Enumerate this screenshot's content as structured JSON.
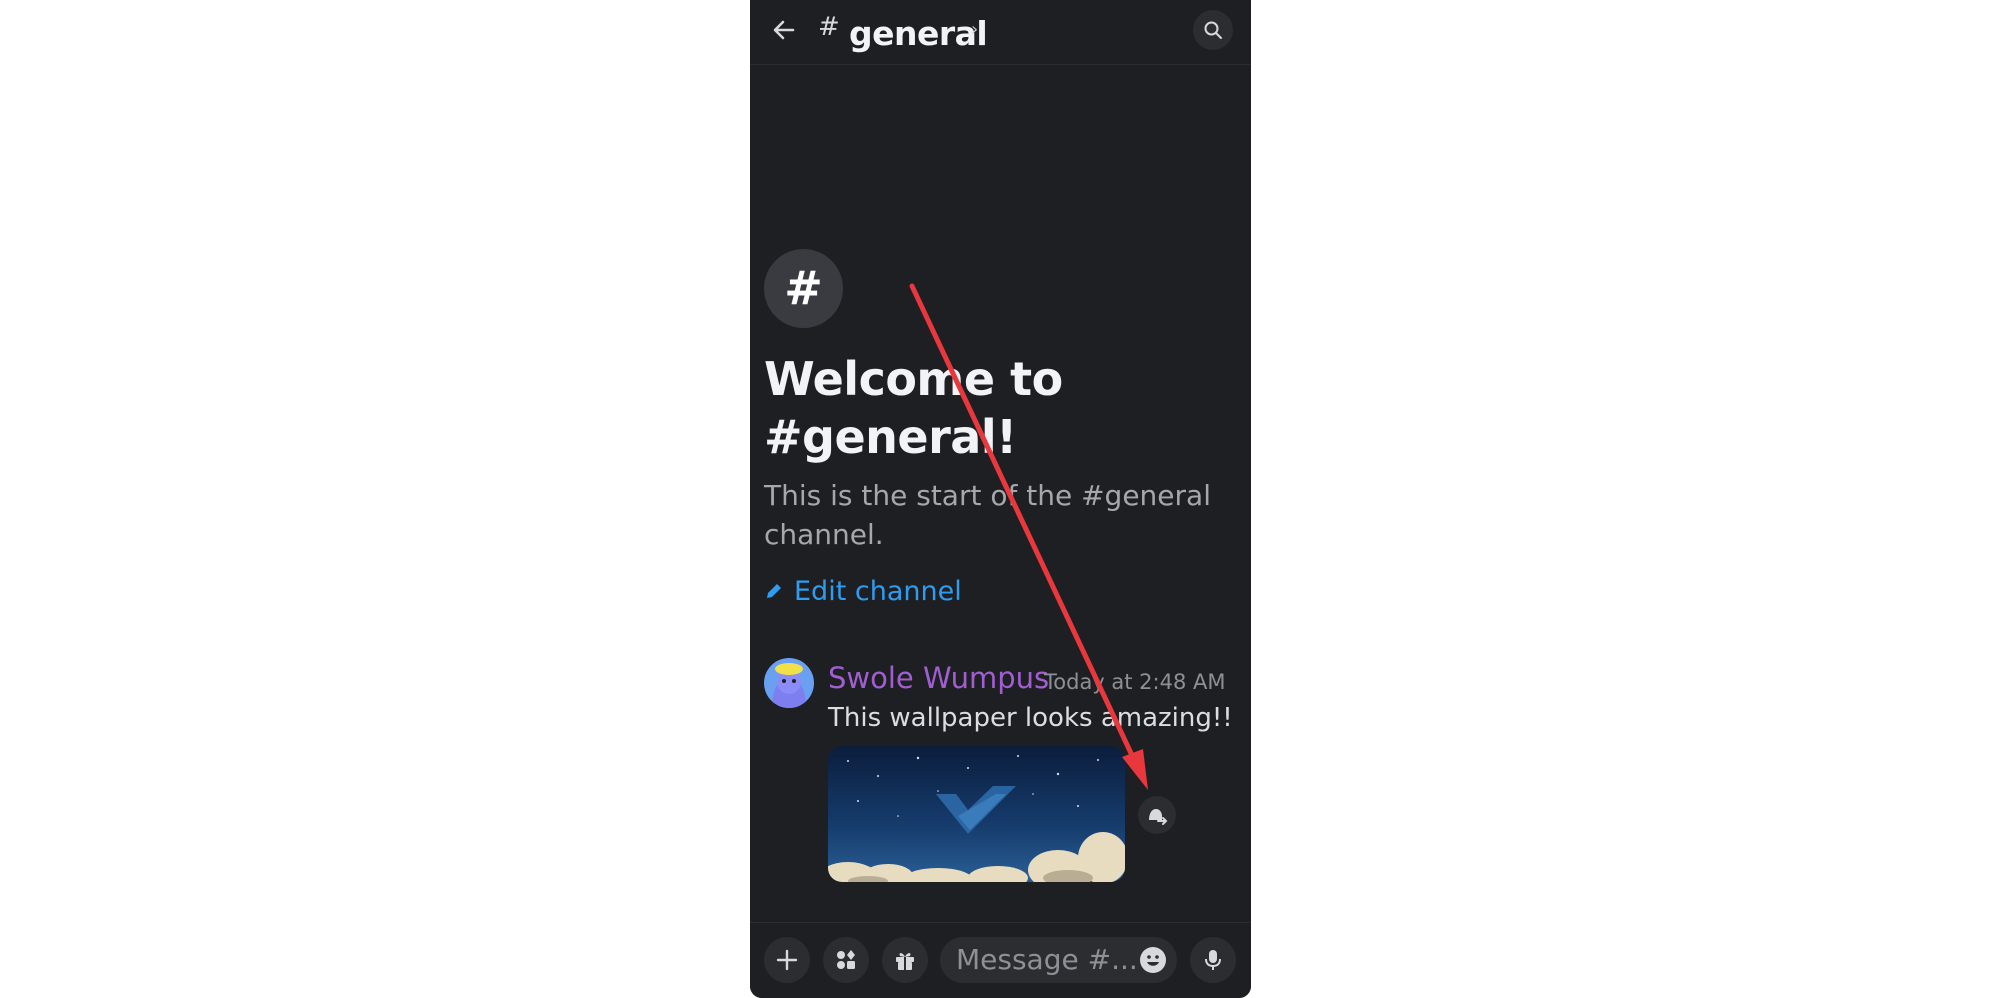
{
  "header": {
    "hash": "#",
    "channel_name": "general",
    "chevron": "›",
    "icons": {
      "back": "arrow-left-icon",
      "search": "search-icon"
    }
  },
  "welcome": {
    "hash_symbol": "#",
    "title": "Welcome to #general!",
    "subtitle": "This is the start of the #general channel.",
    "edit_label": "Edit channel",
    "edit_icon": "pencil-icon"
  },
  "message": {
    "username": "Swole Wumpus",
    "timestamp": "Today at 2:48 AM",
    "text": "This wallpaper looks amazing!!",
    "username_color": "#a15ed1",
    "attachment_icon": "forward-icon"
  },
  "composer": {
    "placeholder": "Message #...",
    "icons": [
      "plus-icon",
      "apps-icon",
      "gift-icon",
      "emoji-icon",
      "microphone-icon"
    ]
  },
  "annotation": {
    "color": "#e8383d"
  },
  "colors": {
    "background": "#1e1f22",
    "surface": "#2b2d31",
    "link": "#2e9cf0"
  }
}
